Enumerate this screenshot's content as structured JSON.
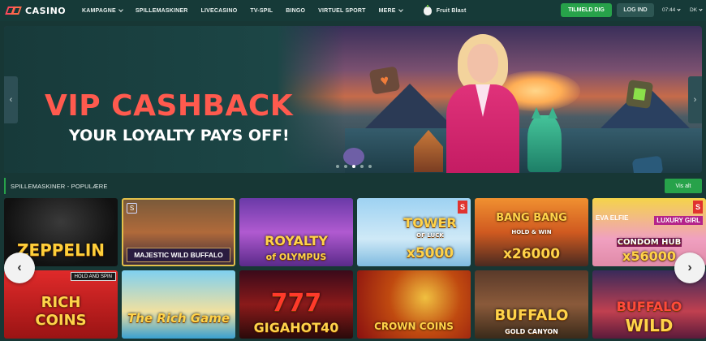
{
  "nav": {
    "logo_text": "CASINO",
    "items": [
      {
        "label": "KAMPAGNE",
        "has_dropdown": true
      },
      {
        "label": "SPILLEMASKINER",
        "has_dropdown": false
      },
      {
        "label": "LIVECASINO",
        "has_dropdown": false
      },
      {
        "label": "TV-SPIL",
        "has_dropdown": false
      },
      {
        "label": "BINGO",
        "has_dropdown": false
      },
      {
        "label": "VIRTUEL SPORT",
        "has_dropdown": false
      },
      {
        "label": "MERE",
        "has_dropdown": true
      }
    ],
    "featured_game": "Fruit Blast",
    "signup_label": "TILMELD DIG",
    "login_label": "LOG IND",
    "time": "07:44",
    "language": "DK"
  },
  "hero": {
    "title": "VIP CASHBACK",
    "subtitle": "YOUR LOYALTY PAYS OFF!",
    "prev_icon": "‹",
    "next_icon": "›",
    "slide_count": 5,
    "active_slide": 3
  },
  "section": {
    "title": "SPILLEMASKINER - POPULÆRE",
    "view_all_label": "Vis alt"
  },
  "games": [
    {
      "title": "ZEPPELIN"
    },
    {
      "title": "MAJESTIC WILD BUFFALO",
      "provider_badge": "S"
    },
    {
      "title": "ROYALTY",
      "subtitle": "of OLYMPUS"
    },
    {
      "title": "TOWER",
      "subtitle": "OF LUCK",
      "multiplier": "x5000",
      "provider_badge": "S"
    },
    {
      "title": "BANG BANG",
      "subtitle": "HOLD & WIN",
      "multiplier": "x26000"
    },
    {
      "title": "CONDOM HUB",
      "top_left": "EVA ELFIE",
      "top_right": "LUXURY GIRL",
      "multiplier": "x56000",
      "provider_badge": "S"
    },
    {
      "title": "RICH",
      "subtitle": "COINS",
      "tag": "HOLD AND SPIN"
    },
    {
      "title": "The Rich Game"
    },
    {
      "title": "777",
      "subtitle": "GIGAHOT40"
    },
    {
      "title": "CROWN COINS"
    },
    {
      "title": "BUFFALO",
      "subtitle": "GOLD CANYON"
    },
    {
      "title": "BUFFALO",
      "subtitle": "WILD"
    }
  ],
  "carousel": {
    "prev_icon": "‹",
    "next_icon": "›"
  },
  "colors": {
    "background": "#173735",
    "accent_green": "#27a24a",
    "hero_title": "#ff5a4e"
  }
}
